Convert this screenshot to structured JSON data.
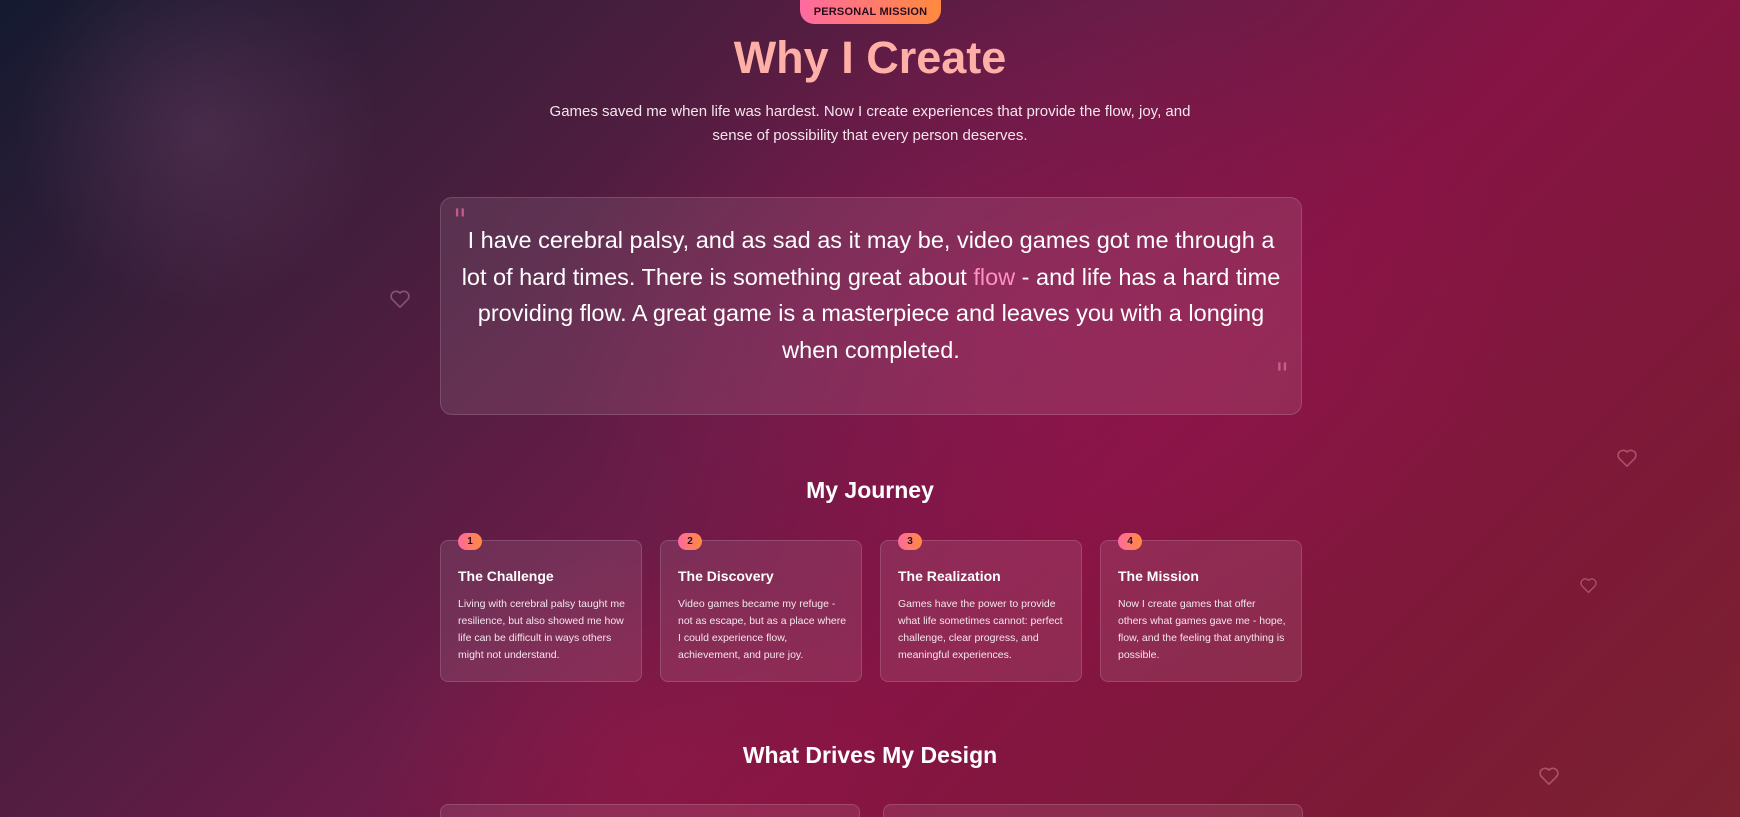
{
  "header": {
    "badge": "PERSONAL MISSION",
    "title": "Why I Create",
    "subtitle": "Games saved me when life was hardest. Now I create experiences that provide the flow, joy, and sense of possibility that every person deserves."
  },
  "quote": {
    "open_mark": "\"",
    "close_mark": "\"",
    "text_before": "I have cerebral palsy, and as sad as it may be, video games got me through a lot of hard times. There is something great about ",
    "highlight": "flow",
    "text_after": " - and life has a hard time providing flow. A great game is a masterpiece and leaves you with a longing when completed."
  },
  "journey": {
    "title": "My Journey",
    "steps": [
      {
        "num": "1",
        "title": "The Challenge",
        "text": "Living with cerebral palsy taught me resilience, but also showed me how life can be difficult in ways others might not understand."
      },
      {
        "num": "2",
        "title": "The Discovery",
        "text": "Video games became my refuge - not as escape, but as a place where I could experience flow, achievement, and pure joy."
      },
      {
        "num": "3",
        "title": "The Realization",
        "text": "Games have the power to provide what life sometimes cannot: perfect challenge, clear progress, and meaningful experiences."
      },
      {
        "num": "4",
        "title": "The Mission",
        "text": "Now I create games that offer others what games gave me - hope, flow, and the feeling that anything is possible."
      }
    ]
  },
  "drives": {
    "title": "What Drives My Design"
  },
  "decor": {
    "heart_icon": "heart-outline-icon",
    "accent_gradient": [
      "#ff6aa0",
      "#ff8a3d"
    ],
    "title_color": "#ffb0a6",
    "highlight_color": "#ff8fc4"
  }
}
